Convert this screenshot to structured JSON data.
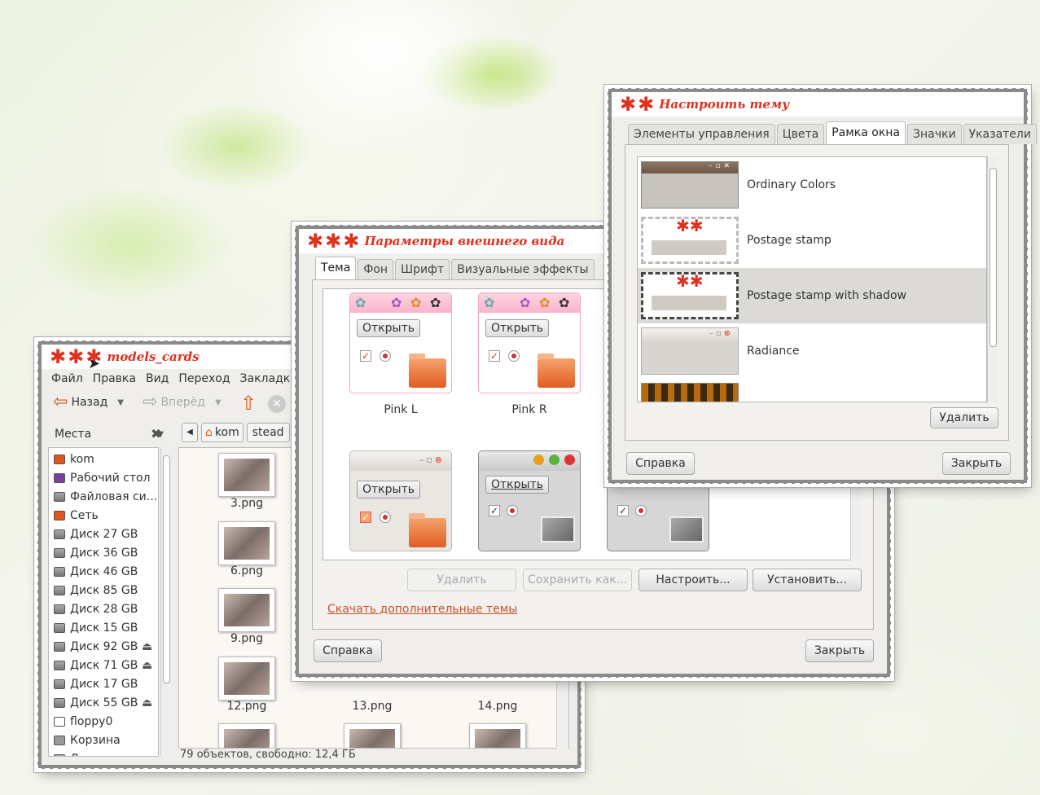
{
  "file_manager": {
    "title": "models_cards",
    "menu": [
      "Файл",
      "Правка",
      "Вид",
      "Переход",
      "Закладк"
    ],
    "back": "Назад",
    "forward": "Вперёд",
    "places_label": "Места",
    "crumbs": [
      "kom",
      "stead"
    ],
    "places": [
      "kom",
      "Рабочий стол",
      "Файловая си...",
      "Сеть",
      "Диск 27 GB",
      "Диск 36 GB",
      "Диск 46 GB",
      "Диск 85 GB",
      "Диск 28 GB",
      "Диск 15 GB",
      "Диск 92 GB",
      "Диск 71 GB",
      "Диск 17 GB",
      "Диск 55 GB",
      "floppy0",
      "Корзина",
      "Документы"
    ],
    "files": [
      "3.png",
      "6.png",
      "9.png",
      "12.png",
      "13.png",
      "14.png"
    ],
    "status": "79 объектов, свободно: 12,4 ГБ"
  },
  "appearance": {
    "title": "Параметры внешнего вида",
    "tabs": [
      "Тема",
      "Фон",
      "Шрифт",
      "Визуальные эффекты"
    ],
    "themes": [
      {
        "name": "Pink L",
        "open": "Открыть"
      },
      {
        "name": "Pink R",
        "open": "Открыть"
      },
      {
        "name": "",
        "open": "Открыть"
      },
      {
        "name": "",
        "open": "Открыть"
      }
    ],
    "buttons": {
      "delete": "Удалить",
      "save_as": "Сохранить как...",
      "customize": "Настроить...",
      "install": "Установить..."
    },
    "more_link": "Скачать дополнительные темы",
    "help": "Справка",
    "close": "Закрыть"
  },
  "customize": {
    "title": "Настроить тему",
    "tabs": [
      "Элементы управления",
      "Цвета",
      "Рамка окна",
      "Значки",
      "Указатели"
    ],
    "borders": [
      "Ordinary Colors",
      "Postage stamp",
      "Postage stamp with shadow",
      "Radiance"
    ],
    "delete": "Удалить",
    "help": "Справка",
    "close": "Закрыть"
  },
  "colors": {
    "accent": "#e0301e",
    "link": "#c8502a"
  }
}
